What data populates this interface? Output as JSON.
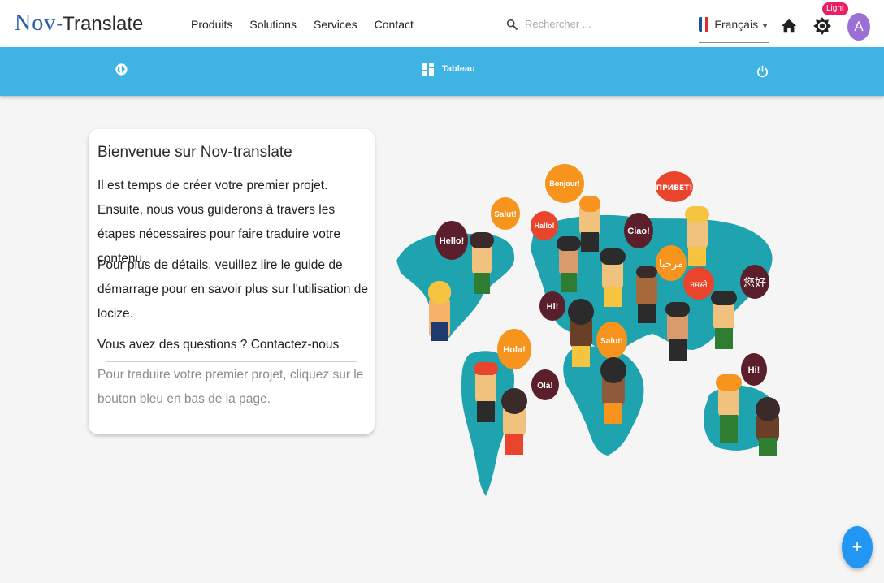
{
  "header": {
    "logo": {
      "part1": "Nov",
      "part2": "-",
      "part3": "Translate"
    },
    "nav": [
      "Produits",
      "Solutions",
      "Services",
      "Contact"
    ],
    "search": {
      "placeholder": "Rechercher ...",
      "icon": "search-icon"
    },
    "language": {
      "label": "Français",
      "flag_colors": [
        "#1f4fa0",
        "#ffffff",
        "#e02b2b"
      ]
    },
    "theme_badge": "Light",
    "avatar_initial": "A"
  },
  "toolbar": {
    "left_icon": "globe-icon",
    "dashboard_label": "Tableau",
    "right_icon": "power-icon",
    "color": "#3fb3e4"
  },
  "card": {
    "title": "Bienvenue sur Nov-translate",
    "p1": "Il est temps de créer votre premier projet. Ensuite, nous vous guiderons à travers les étapes nécessaires pour faire traduire votre contenu.",
    "p2": "Pour plus de détails, veuillez lire le guide de démarrage pour en savoir plus sur l'utilisation de locize.",
    "p3": "Vous avez des questions ? Contactez-nous",
    "p4": "Pour traduire votre premier projet, cliquez sur le bouton bleu en bas de la page."
  },
  "illustration": {
    "bubbles": [
      "Hello!",
      "Salut!",
      "Hallo!",
      "Bonjour!",
      "Ciao!",
      "ПРИВЕТ!",
      "مرحبا",
      "नमस्ते",
      "您好",
      "Hi!",
      "Hola!",
      "Salut!",
      "Olá!",
      "Hi!"
    ]
  },
  "fab": {
    "label": "+"
  },
  "colors": {
    "accent": "#2196f3",
    "badge": "#e91e63",
    "avatar": "#9c6fd6"
  }
}
